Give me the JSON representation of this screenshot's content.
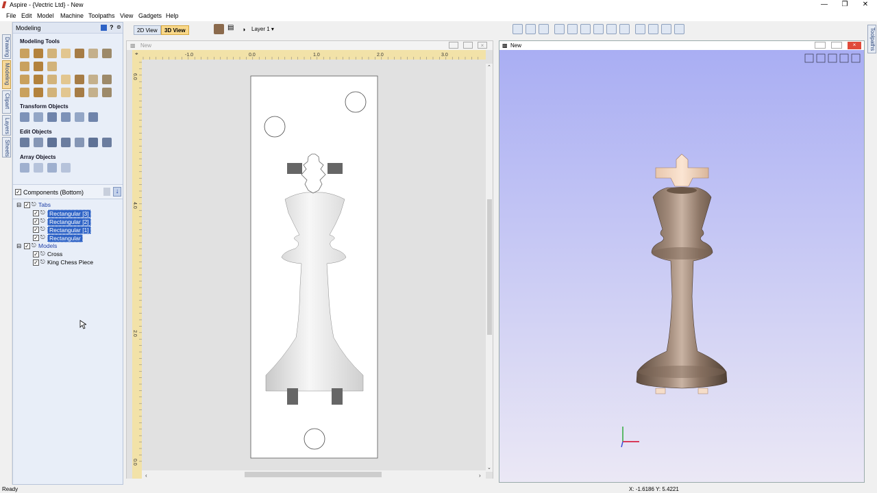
{
  "window": {
    "title": "Aspire - {Vectric Ltd} - New",
    "controls": [
      "minimize-icon",
      "restore-icon",
      "close-icon"
    ]
  },
  "menu": [
    "File",
    "Edit",
    "Model",
    "Machine",
    "Toolpaths",
    "View",
    "Gadgets",
    "Help"
  ],
  "left_tabs": [
    "Drawing",
    "Modeling",
    "Clipart",
    "Layers",
    "Sheets"
  ],
  "right_tabs": [
    "Toolpaths"
  ],
  "panel": {
    "title": "Modeling",
    "sections": {
      "modeling_tools": "Modeling Tools",
      "transform_objects": "Transform Objects",
      "edit_objects": "Edit Objects",
      "array_objects": "Array Objects"
    }
  },
  "components": {
    "header": "Components (Bottom)",
    "groups": [
      {
        "label": "Tabs",
        "items": [
          "Rectangular [3]",
          "Rectangular [2]",
          "Rectangular [1]",
          "Rectangular"
        ]
      },
      {
        "label": "Models",
        "items": [
          "Cross",
          "King Chess Piece"
        ]
      }
    ]
  },
  "view_tabs": [
    "2D View",
    "3D View"
  ],
  "layer": {
    "label": "Layer 1"
  },
  "view2d": {
    "title": "New",
    "ruler_h": [
      "-1.0",
      "0.0",
      "1.0",
      "2.0",
      "3.0"
    ],
    "ruler_v": [
      "6.0",
      "4.0",
      "2.0",
      "0.0"
    ]
  },
  "view3d": {
    "title": "New"
  },
  "status": {
    "left": "Ready",
    "coords": "X: -1.6186 Y: 5.4221"
  },
  "colors": {
    "accent": "#f9d889",
    "selection": "#2e63c6",
    "bg3d_top": "#aab0f0",
    "bg3d_bottom": "#e9e6f4"
  }
}
